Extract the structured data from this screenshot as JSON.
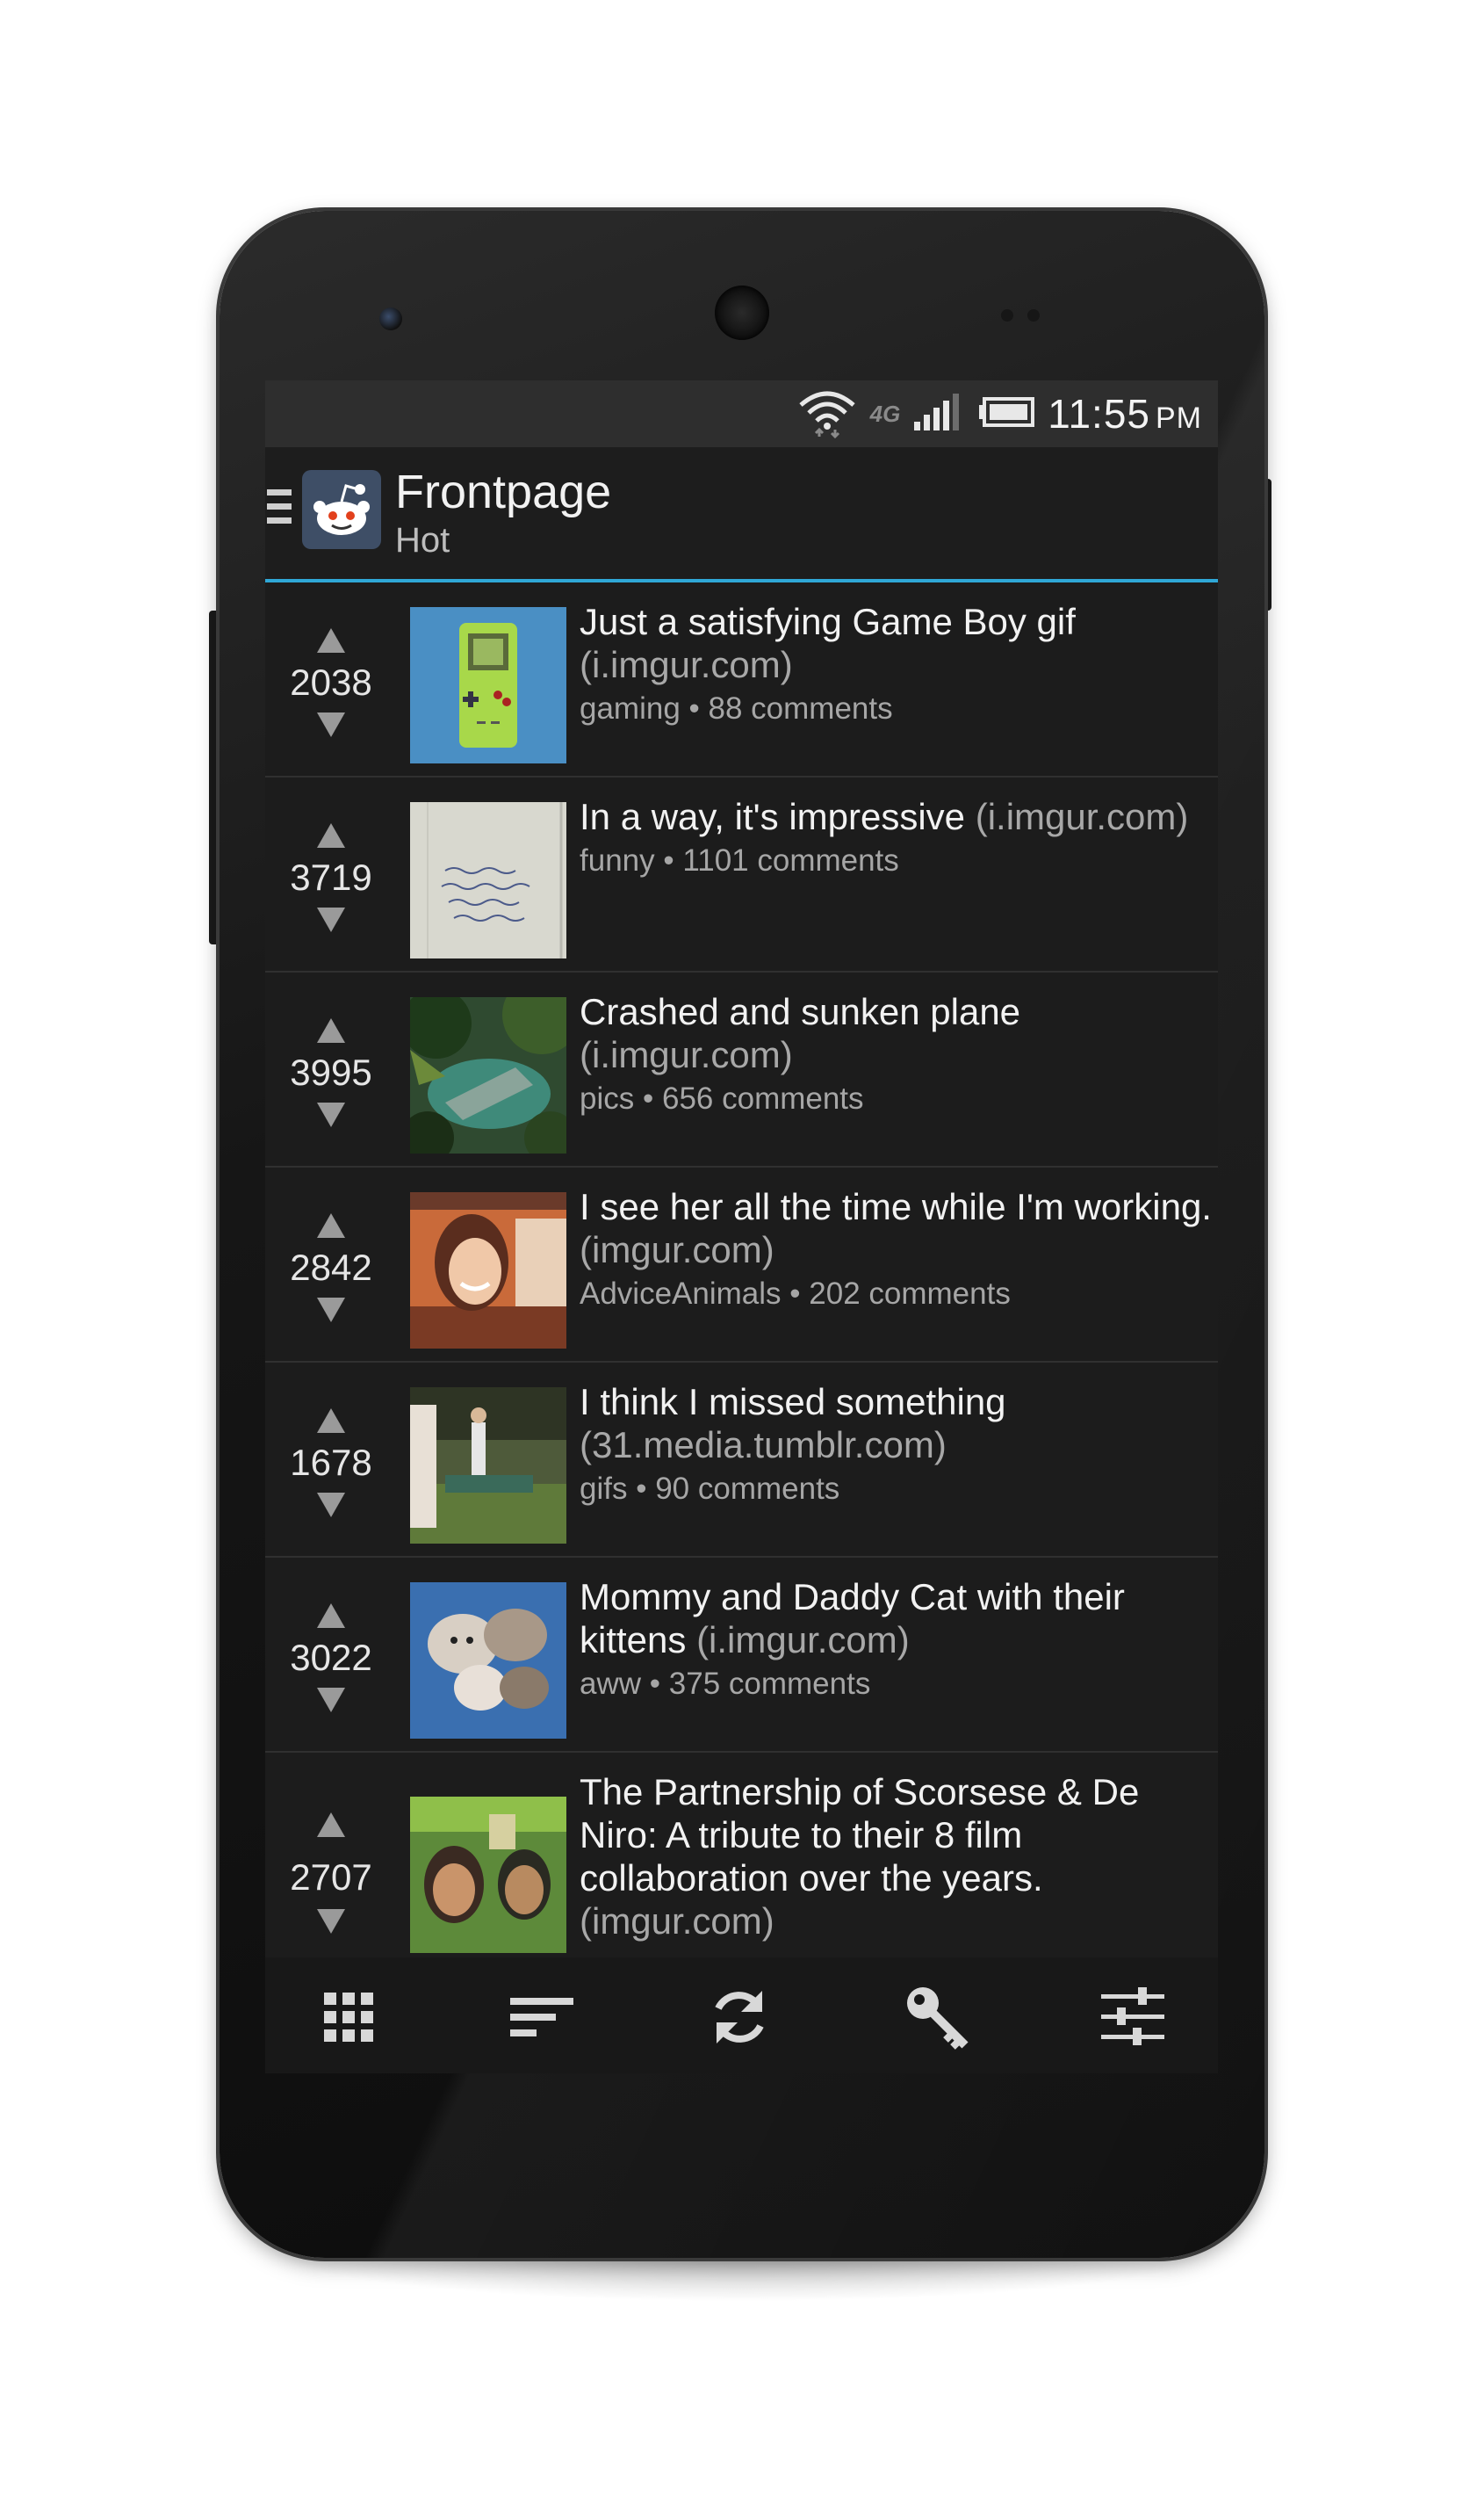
{
  "status_bar": {
    "network": "4G",
    "time": "11:55",
    "ampm": "PM"
  },
  "action_bar": {
    "title": "Frontpage",
    "subtitle": "Hot"
  },
  "posts": [
    {
      "score": "2038",
      "title": "Just a satisfying Game Boy gif",
      "domain": "(i.imgur.com)",
      "subreddit": "gaming",
      "comments": "88 comments"
    },
    {
      "score": "3719",
      "title": "In a way, it's impressive",
      "domain": "(i.imgur.com)",
      "subreddit": "funny",
      "comments": "1101 comments"
    },
    {
      "score": "3995",
      "title": "Crashed and sunken plane",
      "domain": "(i.imgur.com)",
      "subreddit": "pics",
      "comments": "656 comments"
    },
    {
      "score": "2842",
      "title": "I see her all the time while I'm working.",
      "domain": "(imgur.com)",
      "subreddit": "AdviceAnimals",
      "comments": "202 comments"
    },
    {
      "score": "1678",
      "title": "I think I missed something",
      "domain": "(31.media.tumblr.com)",
      "subreddit": "gifs",
      "comments": "90 comments"
    },
    {
      "score": "3022",
      "title": "Mommy and Daddy Cat with their kittens",
      "domain": "(i.imgur.com)",
      "subreddit": "aww",
      "comments": "375 comments"
    },
    {
      "score": "2707",
      "title": "The Partnership of Scorsese & De Niro: A tribute to their 8 film collaboration over the years.",
      "domain": "(imgur.com)",
      "subreddit": "",
      "comments": ""
    }
  ],
  "meta_separator": "•",
  "bottom_bar": {
    "icons": [
      "grid-icon",
      "sort-icon",
      "refresh-icon",
      "key-icon",
      "sliders-icon"
    ]
  },
  "colors": {
    "accent": "#2fa7d6",
    "background": "#1c1c1c",
    "text": "#f2f2f2",
    "muted": "#a6a6a6"
  }
}
